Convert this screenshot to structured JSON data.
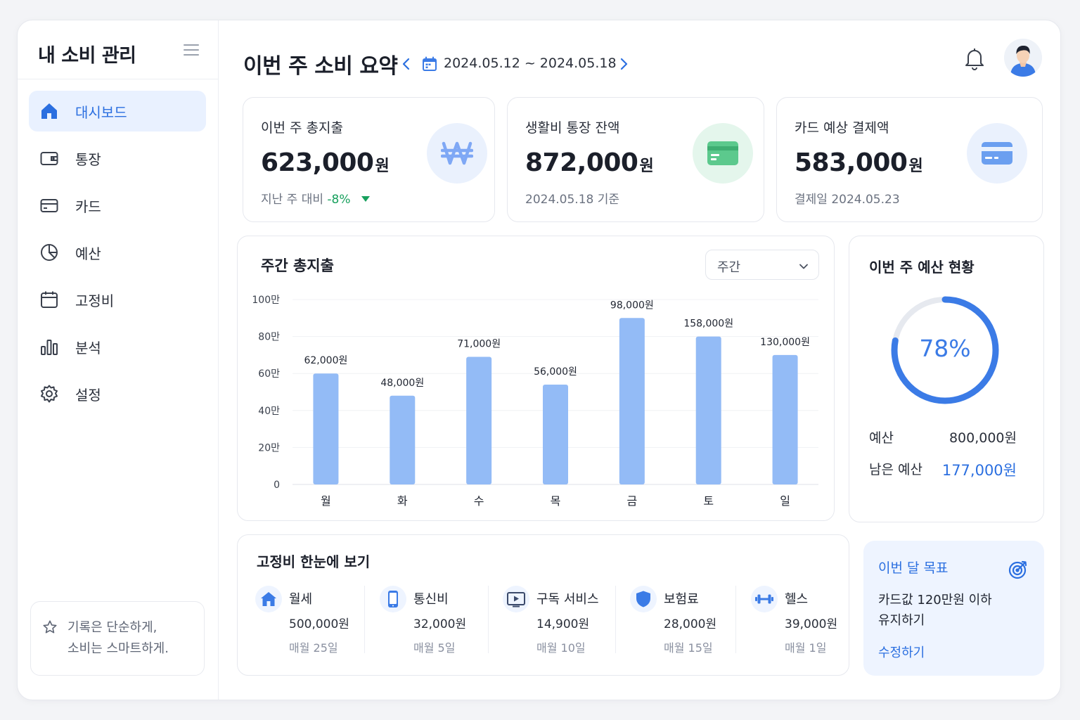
{
  "app": {
    "title": "내 소비 관리"
  },
  "sidebar": {
    "items": [
      {
        "label": "대시보드",
        "icon": "home-icon",
        "active": true
      },
      {
        "label": "통장",
        "icon": "wallet-icon",
        "active": false
      },
      {
        "label": "카드",
        "icon": "credit-card-icon",
        "active": false
      },
      {
        "label": "예산",
        "icon": "pie-chart-icon",
        "active": false
      },
      {
        "label": "고정비",
        "icon": "calendar-icon",
        "active": false
      },
      {
        "label": "분석",
        "icon": "bar-chart-icon",
        "active": false
      },
      {
        "label": "설정",
        "icon": "gear-icon",
        "active": false
      }
    ],
    "quote": {
      "line1": "기록은 단순하게,",
      "line2": "소비는 스마트하게."
    }
  },
  "header": {
    "title": "이번 주 소비 요약",
    "date_range": "2024.05.12 ~ 2024.05.18"
  },
  "stats": [
    {
      "label": "이번 주 총지출",
      "value": "623,000",
      "unit": "원",
      "sub_prefix": "지난 주 대비 ",
      "sub_change": "-8%",
      "icon": "won-icon",
      "accent": "#7fa8f5"
    },
    {
      "label": "생활비 통장 잔액",
      "value": "872,000",
      "unit": "원",
      "sub": "2024.05.18 기준",
      "icon": "bankbook-icon",
      "accent": "#5cc98d"
    },
    {
      "label": "카드 예상 결제액",
      "value": "583,000",
      "unit": "원",
      "sub": "결제일 2024.05.23",
      "icon": "credit-card-icon",
      "accent": "#6b9ff0"
    }
  ],
  "weekly": {
    "title": "주간 총지출",
    "period_select": "주간"
  },
  "chart_data": {
    "type": "bar",
    "title": "주간 총지출",
    "categories": [
      "월",
      "화",
      "수",
      "목",
      "금",
      "토",
      "일"
    ],
    "values": [
      600000,
      480000,
      690000,
      540000,
      900000,
      800000,
      700000
    ],
    "data_labels": [
      "62,000원",
      "48,000원",
      "71,000원",
      "56,000원",
      "98,000원",
      "158,000원",
      "130,000원"
    ],
    "y_ticks": [
      "0",
      "20만",
      "40만",
      "60만",
      "80만",
      "100만"
    ],
    "ylim": [
      0,
      1000000
    ],
    "grid": true,
    "bar_color": "#93bbf6"
  },
  "budget": {
    "title": "이번 주 예산 현황",
    "percent": 78,
    "percent_label": "78%",
    "budget_label": "예산",
    "budget_value": "800,000원",
    "remaining_label": "남은 예산",
    "remaining_value": "177,000원",
    "ring_color": "#3b7be6"
  },
  "fixed": {
    "title": "고정비 한눈에 보기",
    "items": [
      {
        "name": "월세",
        "amount": "500,000원",
        "date": "매월 25일",
        "icon": "house-icon"
      },
      {
        "name": "통신비",
        "amount": "32,000원",
        "date": "매월 5일",
        "icon": "smartphone-icon"
      },
      {
        "name": "구독 서비스",
        "amount": "14,900원",
        "date": "매월 10일",
        "icon": "play-icon"
      },
      {
        "name": "보험료",
        "amount": "28,000원",
        "date": "매월 15일",
        "icon": "shield-icon"
      },
      {
        "name": "헬스",
        "amount": "39,000원",
        "date": "매월 1일",
        "icon": "dumbbell-icon"
      }
    ]
  },
  "goal": {
    "title": "이번 달 목표",
    "line1": "카드값 120만원 이하",
    "line2": "유지하기",
    "edit_label": "수정하기"
  }
}
